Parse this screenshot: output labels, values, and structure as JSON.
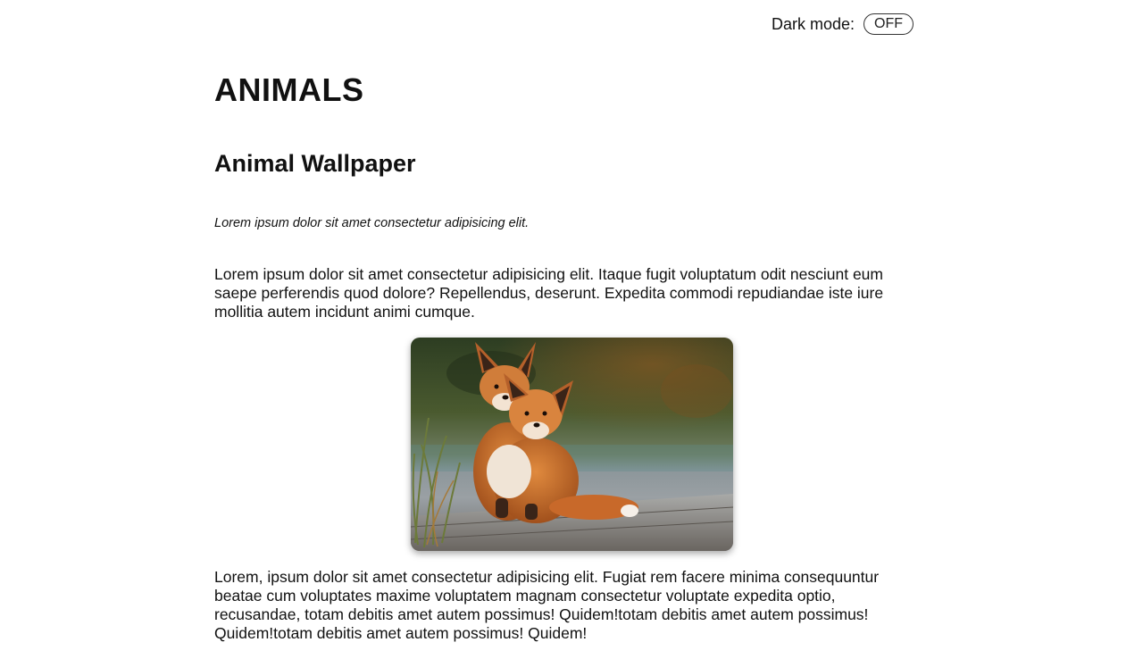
{
  "header": {
    "dark_mode_label": "Dark mode:",
    "dark_mode_toggle": "OFF"
  },
  "main": {
    "title": "ANIMALS",
    "heading": "Animal Wallpaper",
    "subtitle": "Lorem ipsum dolor sit amet consectetur adipisicing elit.",
    "paragraph1": "Lorem ipsum dolor sit amet consectetur adipisicing elit. Itaque fugit voluptatum odit nesciunt eum saepe perferendis quod dolore? Repellendus, deserunt. Expedita commodi repudiandae iste iure mollitia autem incidunt animi cumque.",
    "image": {
      "icon": "fox-photo"
    },
    "paragraph2": "Lorem, ipsum dolor sit amet consectetur adipisicing elit. Fugiat rem facere minima consequuntur beatae cum voluptates maxime voluptatem magnam consectetur voluptate expedita optio, recusandae, totam debitis amet autem possimus! Quidem!totam debitis amet autem possimus! Quidem!totam debitis amet autem possimus! Quidem!"
  },
  "colors": {
    "text": "#111111",
    "background": "#ffffff",
    "fox_fur": "#c8692a"
  }
}
